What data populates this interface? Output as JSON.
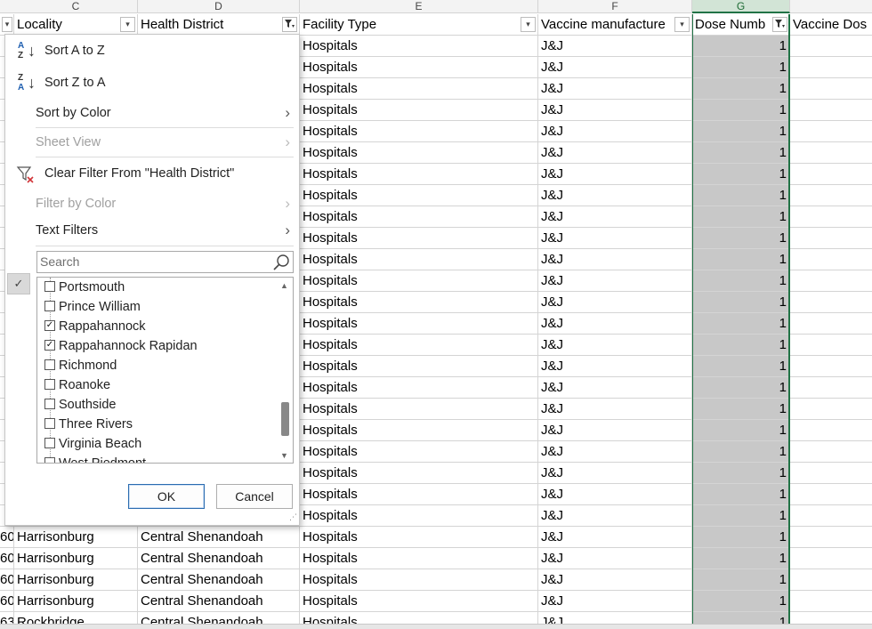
{
  "columns": {
    "letters": [
      "C",
      "D",
      "E",
      "F",
      "G"
    ],
    "headers": [
      "Locality",
      "Health District",
      "Facility Type",
      "Vaccine manufacture",
      "Dose Numb",
      "Vaccine Dos"
    ]
  },
  "rows": [
    {
      "a": "",
      "locality": "",
      "district": "",
      "facility": "Hospitals",
      "manufacturer": "J&J",
      "dose": "1"
    },
    {
      "a": "",
      "locality": "",
      "district": "",
      "facility": "Hospitals",
      "manufacturer": "J&J",
      "dose": "1"
    },
    {
      "a": "",
      "locality": "",
      "district": "",
      "facility": "Hospitals",
      "manufacturer": "J&J",
      "dose": "1"
    },
    {
      "a": "",
      "locality": "",
      "district": "",
      "facility": "Hospitals",
      "manufacturer": "J&J",
      "dose": "1"
    },
    {
      "a": "",
      "locality": "",
      "district": "",
      "facility": "Hospitals",
      "manufacturer": "J&J",
      "dose": "1"
    },
    {
      "a": "",
      "locality": "",
      "district": "",
      "facility": "Hospitals",
      "manufacturer": "J&J",
      "dose": "1"
    },
    {
      "a": "",
      "locality": "",
      "district": "",
      "facility": "Hospitals",
      "manufacturer": "J&J",
      "dose": "1"
    },
    {
      "a": "",
      "locality": "",
      "district": "",
      "facility": "Hospitals",
      "manufacturer": "J&J",
      "dose": "1"
    },
    {
      "a": "",
      "locality": "",
      "district": "",
      "facility": "Hospitals",
      "manufacturer": "J&J",
      "dose": "1"
    },
    {
      "a": "",
      "locality": "",
      "district": "",
      "facility": "Hospitals",
      "manufacturer": "J&J",
      "dose": "1"
    },
    {
      "a": "",
      "locality": "",
      "district": "",
      "facility": "Hospitals",
      "manufacturer": "J&J",
      "dose": "1"
    },
    {
      "a": "",
      "locality": "",
      "district": "",
      "facility": "Hospitals",
      "manufacturer": "J&J",
      "dose": "1"
    },
    {
      "a": "",
      "locality": "",
      "district": "",
      "facility": "Hospitals",
      "manufacturer": "J&J",
      "dose": "1"
    },
    {
      "a": "",
      "locality": "",
      "district": "",
      "facility": "Hospitals",
      "manufacturer": "J&J",
      "dose": "1"
    },
    {
      "a": "",
      "locality": "",
      "district": "",
      "facility": "Hospitals",
      "manufacturer": "J&J",
      "dose": "1"
    },
    {
      "a": "",
      "locality": "",
      "district": "",
      "facility": "Hospitals",
      "manufacturer": "J&J",
      "dose": "1"
    },
    {
      "a": "",
      "locality": "",
      "district": "",
      "facility": "Hospitals",
      "manufacturer": "J&J",
      "dose": "1"
    },
    {
      "a": "",
      "locality": "",
      "district": "",
      "facility": "Hospitals",
      "manufacturer": "J&J",
      "dose": "1"
    },
    {
      "a": "",
      "locality": "",
      "district": "",
      "facility": "Hospitals",
      "manufacturer": "J&J",
      "dose": "1"
    },
    {
      "a": "",
      "locality": "",
      "district": "",
      "facility": "Hospitals",
      "manufacturer": "J&J",
      "dose": "1"
    },
    {
      "a": "",
      "locality": "",
      "district": "",
      "facility": "Hospitals",
      "manufacturer": "J&J",
      "dose": "1"
    },
    {
      "a": "",
      "locality": "",
      "district": "",
      "facility": "Hospitals",
      "manufacturer": "J&J",
      "dose": "1"
    },
    {
      "a": "",
      "locality": "",
      "district": "",
      "facility": "Hospitals",
      "manufacturer": "J&J",
      "dose": "1"
    },
    {
      "a": "60",
      "locality": "Harrisonburg",
      "district": "Central Shenandoah",
      "facility": "Hospitals",
      "manufacturer": "J&J",
      "dose": "1"
    },
    {
      "a": "60",
      "locality": "Harrisonburg",
      "district": "Central Shenandoah",
      "facility": "Hospitals",
      "manufacturer": "J&J",
      "dose": "1"
    },
    {
      "a": "60",
      "locality": "Harrisonburg",
      "district": "Central Shenandoah",
      "facility": "Hospitals",
      "manufacturer": "J&J",
      "dose": "1"
    },
    {
      "a": "60",
      "locality": "Harrisonburg",
      "district": "Central Shenandoah",
      "facility": "Hospitals",
      "manufacturer": "J&J",
      "dose": "1"
    },
    {
      "a": "63",
      "locality": "Rockbridge",
      "district": "Central Shenandoah",
      "facility": "Hospitals",
      "manufacturer": "J&J",
      "dose": "1"
    }
  ],
  "filter_menu": {
    "sort_az": "Sort A to Z",
    "sort_za": "Sort Z to A",
    "sort_by_color": "Sort by Color",
    "sheet_view": "Sheet View",
    "clear_filter": "Clear Filter From \"Health District\"",
    "filter_by_color": "Filter by Color",
    "text_filters": "Text Filters",
    "search_placeholder": "Search",
    "items": [
      {
        "label": "Portsmouth",
        "checked": false
      },
      {
        "label": "Prince William",
        "checked": false
      },
      {
        "label": "Rappahannock",
        "checked": true
      },
      {
        "label": "Rappahannock Rapidan",
        "checked": true
      },
      {
        "label": "Richmond",
        "checked": false
      },
      {
        "label": "Roanoke",
        "checked": false
      },
      {
        "label": "Southside",
        "checked": false
      },
      {
        "label": "Three Rivers",
        "checked": false
      },
      {
        "label": "Virginia Beach",
        "checked": false
      },
      {
        "label": "West Piedmont",
        "checked": false
      }
    ],
    "ok_label": "OK",
    "cancel_label": "Cancel"
  },
  "colors": {
    "selected_column": "#c8c8c8",
    "excel_green": "#217346",
    "ok_border": "#2b6cb0"
  }
}
